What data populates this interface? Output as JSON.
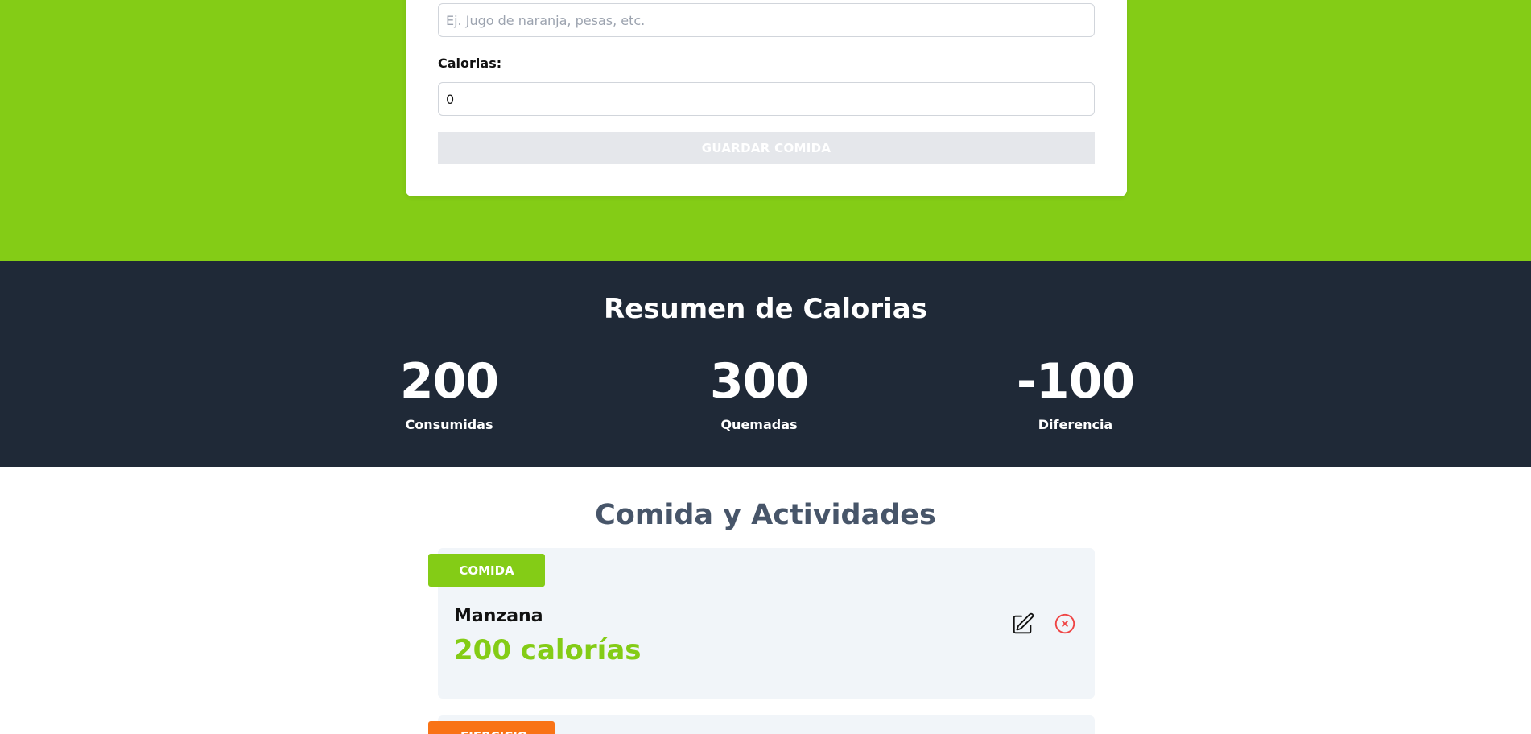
{
  "form": {
    "name_placeholder": "Ej. Jugo de naranja, pesas, etc.",
    "calories_label": "Calorias:",
    "calories_value": "0",
    "save_label": "GUARDAR COMIDA"
  },
  "summary": {
    "title": "Resumen de Calorias",
    "stats": [
      {
        "value": "200",
        "label": "Consumidas"
      },
      {
        "value": "300",
        "label": "Quemadas"
      },
      {
        "value": "-100",
        "label": "Diferencia"
      }
    ]
  },
  "activities": {
    "title": "Comida y Actividades",
    "items": [
      {
        "category": "COMIDA",
        "name": "Manzana",
        "calories_text": "200 calorías",
        "category_color": "#84cc16"
      },
      {
        "category": "EJERCICIO",
        "category_color": "#f97316"
      }
    ]
  },
  "colors": {
    "accent_green": "#84cc16",
    "dark_bg": "#1f2937",
    "title_slate": "#475569",
    "delete_red": "#ef4444",
    "exercise_orange": "#f97316"
  },
  "icons": {
    "edit": "pencil-square-icon",
    "delete": "x-circle-icon"
  }
}
